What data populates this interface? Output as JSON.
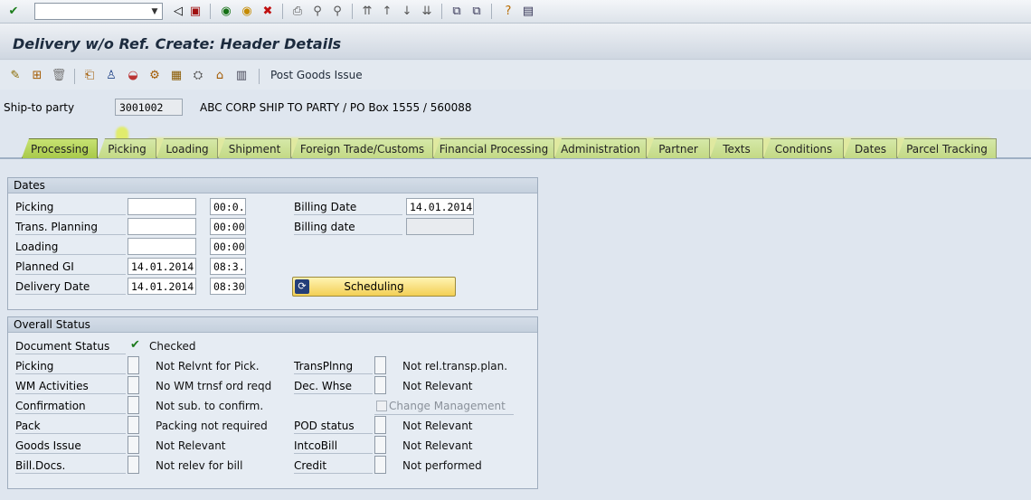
{
  "system_toolbar": {
    "command_field_value": "",
    "icons": [
      "enter-icon",
      "back-icon",
      "save-icon",
      "back-arrow-icon",
      "exit-icon",
      "cancel-icon",
      "print-icon",
      "find-icon",
      "find-next-icon",
      "first-page-icon",
      "prev-page-icon",
      "next-page-icon",
      "last-page-icon",
      "new-session-icon",
      "shortcut-icon",
      "help-icon",
      "layout-icon"
    ]
  },
  "title": "Delivery w/o Ref.  Create: Header Details",
  "app_toolbar": {
    "post_goods_issue_label": "Post Goods Issue"
  },
  "ship_to": {
    "label": "Ship-to party",
    "value": "3001002",
    "description": "ABC CORP SHIP TO PARTY / PO Box 1555 / 560088"
  },
  "tabs": [
    {
      "label": "Processing",
      "active": true
    },
    {
      "label": "Picking"
    },
    {
      "label": "Loading"
    },
    {
      "label": "Shipment"
    },
    {
      "label": "Foreign Trade/Customs"
    },
    {
      "label": "Financial Processing"
    },
    {
      "label": "Administration"
    },
    {
      "label": "Partner"
    },
    {
      "label": "Texts"
    },
    {
      "label": "Conditions"
    },
    {
      "label": "Dates"
    },
    {
      "label": "Parcel Tracking"
    }
  ],
  "dates": {
    "heading": "Dates",
    "rows": [
      {
        "label": "Picking",
        "date": "",
        "time": "00:0..."
      },
      {
        "label": "Trans. Planning",
        "date": "",
        "time": "00:00"
      },
      {
        "label": "Loading",
        "date": "",
        "time": "00:00"
      },
      {
        "label": "Planned GI",
        "date": "14.01.2014",
        "time": "08:3..."
      },
      {
        "label": "Delivery Date",
        "date": "14.01.2014",
        "time": "08:30"
      }
    ],
    "billing_date_label": "Billing Date",
    "billing_date_value": "14.01.2014",
    "billing_date2_label": "Billing date",
    "billing_date2_value": "",
    "scheduling_label": "Scheduling"
  },
  "overall_status": {
    "heading": "Overall Status",
    "document_status_label": "Document Status",
    "document_status_value": "Checked",
    "left": [
      {
        "label": "Picking",
        "value": "Not Relvnt for Pick."
      },
      {
        "label": "WM Activities",
        "value": "No WM trnsf ord reqd"
      },
      {
        "label": "Confirmation",
        "value": "Not sub. to confirm."
      },
      {
        "label": "Pack",
        "value": "Packing not required"
      },
      {
        "label": "Goods Issue",
        "value": "Not Relevant"
      },
      {
        "label": "Bill.Docs.",
        "value": "Not relev for bill"
      }
    ],
    "right": [
      {
        "label": "TransPlnng",
        "value": "Not rel.transp.plan."
      },
      {
        "label": "Dec. Whse",
        "value": "Not Relevant"
      },
      {
        "label": "POD status",
        "value": "Not Relevant"
      },
      {
        "label": "IntcoBill",
        "value": "Not Relevant"
      },
      {
        "label": "Credit",
        "value": "Not performed"
      }
    ],
    "change_management_label": "Change Management"
  },
  "colors": {
    "highlight": "#e1f000",
    "tab_green": "#c3d985",
    "scheduling_yellow": "#f3cf55"
  }
}
